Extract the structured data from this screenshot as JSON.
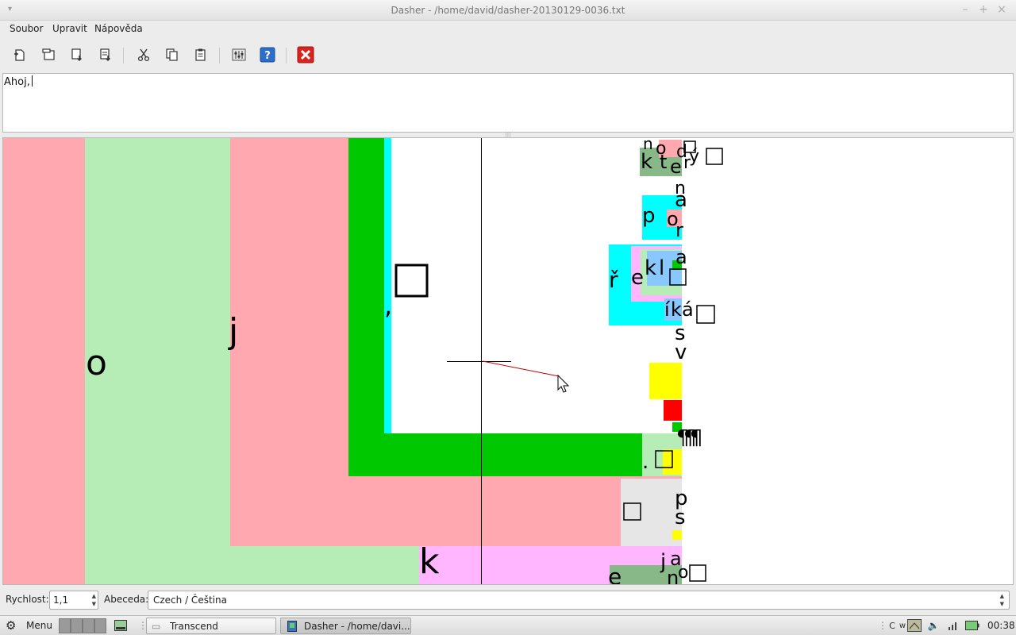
{
  "window": {
    "title": "Dasher - /home/david/dasher-20130129-0036.txt",
    "menu": [
      "Soubor",
      "Upravit",
      "Nápověda"
    ]
  },
  "toolbar_icons": [
    "new-icon",
    "open-icon",
    "save-icon",
    "save-as-icon",
    "cut-icon",
    "copy-icon",
    "paste-icon",
    "preferences-icon",
    "help-icon",
    "quit-icon"
  ],
  "editor": {
    "text": "Ahoj,"
  },
  "dasher": {
    "big_letters": [
      "o",
      "j",
      ",",
      "k"
    ],
    "small_letters": [
      "n",
      "o",
      "d",
      "ý",
      "k",
      "t",
      "e",
      "r",
      "n",
      "a",
      "p",
      "o",
      "r",
      "ř",
      "e",
      "k",
      "l",
      "a",
      "í",
      "k",
      "á",
      "s",
      "v",
      "¶",
      "¶",
      "¶",
      ".",
      "p",
      "s",
      "j",
      "a",
      "e",
      "n",
      "o"
    ]
  },
  "status": {
    "speed_label": "Rychlost:",
    "speed_value": "1,1",
    "alphabet_label": "Abeceda:",
    "alphabet_value": "Czech / Čeština"
  },
  "panel": {
    "menu_label": "Menu",
    "tasks": [
      "Transcend",
      "Dasher - /home/davi..."
    ],
    "clock": "00:38"
  },
  "colors": {
    "pink": "#ffa8b0",
    "light_green": "#b6ecb6",
    "green": "#00c800",
    "cyan": "#00ffff",
    "yellow": "#ffff00",
    "red": "#ff0000",
    "lilac": "#ffb6ff",
    "light_blue": "#88c8ff",
    "grey": "#e6e6e6"
  }
}
